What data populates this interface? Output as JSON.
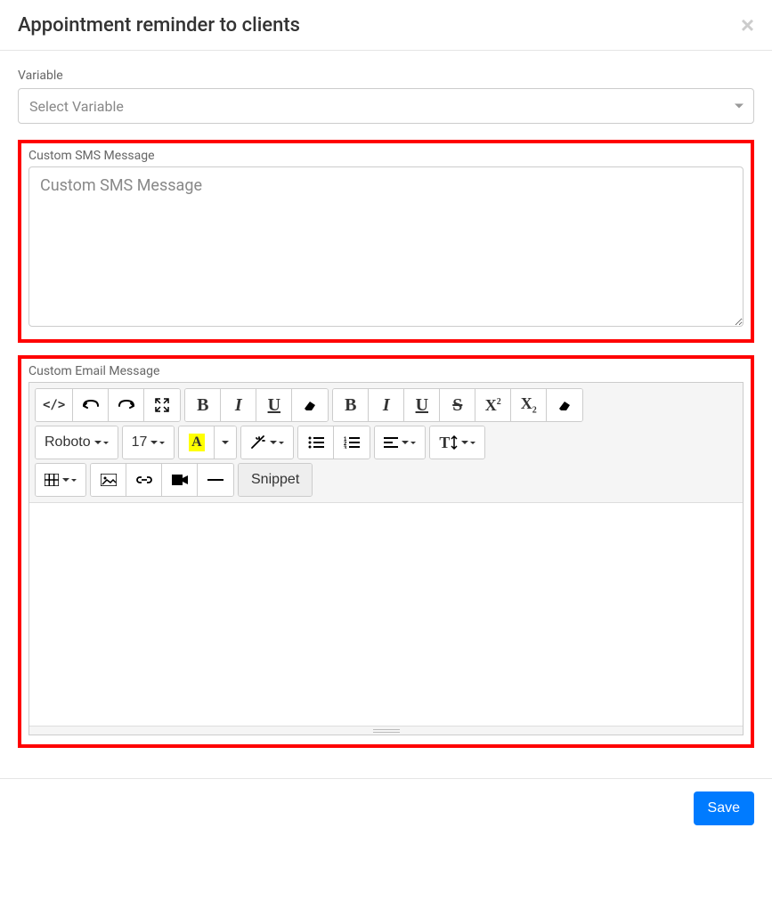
{
  "header": {
    "title": "Appointment reminder to clients"
  },
  "variable": {
    "label": "Variable",
    "placeholder": "Select Variable"
  },
  "sms": {
    "label": "Custom SMS Message",
    "placeholder": "Custom SMS Message",
    "value": ""
  },
  "email": {
    "label": "Custom Email Message",
    "value": ""
  },
  "toolbar": {
    "font_name": "Roboto",
    "font_size": "17",
    "snippet_label": "Snippet"
  },
  "footer": {
    "save_label": "Save"
  }
}
